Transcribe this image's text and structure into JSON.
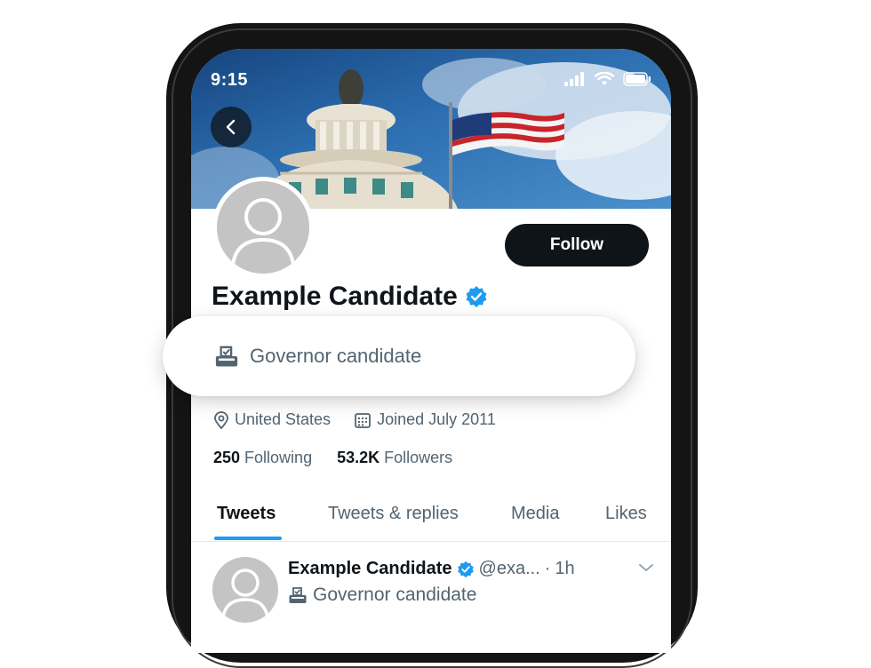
{
  "status_bar": {
    "time": "9:15"
  },
  "profile": {
    "name": "Example Candidate",
    "follow_label": "Follow",
    "label": "Governor candidate",
    "location": "United States",
    "joined": "Joined July 2011",
    "following_count": "250",
    "following_label": "Following",
    "followers_count": "53.2K",
    "followers_label": "Followers"
  },
  "tabs": [
    {
      "label": "Tweets",
      "active": true
    },
    {
      "label": "Tweets & replies",
      "active": false
    },
    {
      "label": "Media",
      "active": false
    },
    {
      "label": "Likes",
      "active": false
    }
  ],
  "tweet": {
    "name": "Example Candidate",
    "handle": "@exa...",
    "separator": "·",
    "time": "1h",
    "label": "Governor candidate"
  },
  "colors": {
    "verified": "#1d9bf0",
    "follow_bg": "#0f1419",
    "secondary_text": "#536471"
  },
  "icons": [
    "back-arrow-icon",
    "signal-icon",
    "wifi-icon",
    "battery-icon",
    "verified-badge-icon",
    "ballot-box-icon",
    "location-pin-icon",
    "calendar-icon",
    "chevron-down-icon"
  ]
}
